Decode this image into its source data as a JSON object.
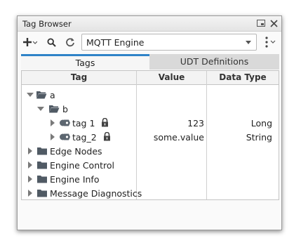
{
  "window": {
    "title": "Tag Browser"
  },
  "toolbar": {
    "provider": "MQTT Engine"
  },
  "tabs": [
    "Tags",
    "UDT Definitions"
  ],
  "columns": {
    "tag": "Tag",
    "value": "Value",
    "type": "Data Type"
  },
  "rows": [
    {
      "label": "a",
      "value": "",
      "type": ""
    },
    {
      "label": "b",
      "value": "",
      "type": ""
    },
    {
      "label": "tag 1",
      "value": "123",
      "type": "Long"
    },
    {
      "label": "tag_2",
      "value": "some.value",
      "type": "String"
    },
    {
      "label": "Edge Nodes",
      "value": "",
      "type": ""
    },
    {
      "label": "Engine Control",
      "value": "",
      "type": ""
    },
    {
      "label": "Engine Info",
      "value": "",
      "type": ""
    },
    {
      "label": "Message Diagnostics",
      "value": "",
      "type": ""
    }
  ],
  "icons": {
    "add": "plus-icon",
    "search": "search-icon",
    "refresh": "refresh-icon",
    "menu": "kebab-menu-icon",
    "minimize": "minimize-window-icon",
    "close": "close-icon"
  },
  "colors": {
    "active_tab_accent": "#2f83c8",
    "folder": "#505a64"
  }
}
